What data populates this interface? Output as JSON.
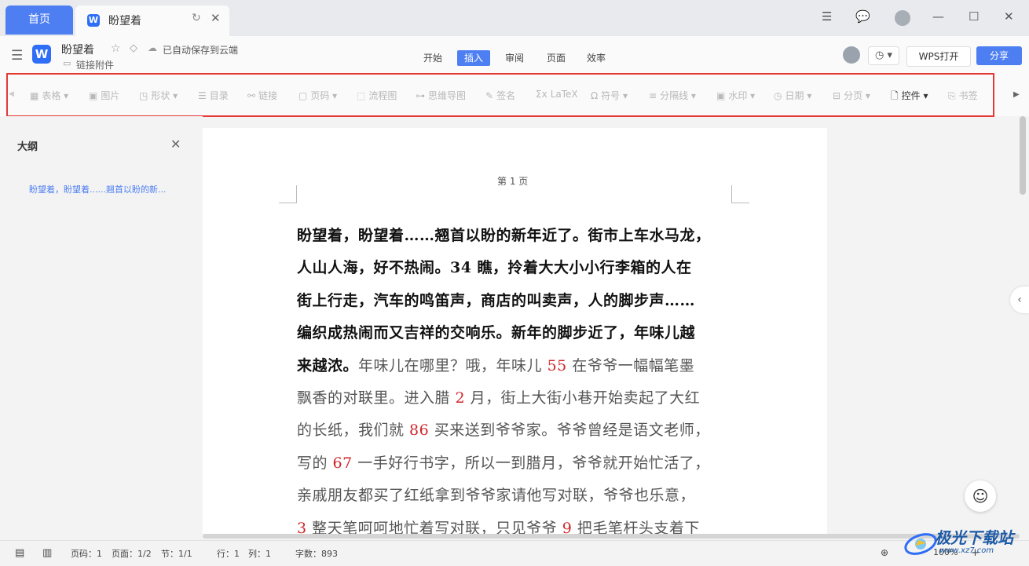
{
  "tabs": {
    "home_label": "首页",
    "doc_title": "盼望着"
  },
  "header": {
    "doc_title": "盼望着",
    "save_status": "已自动保存到云端",
    "attach_link": "链接附件",
    "menu": [
      "开始",
      "插入",
      "审阅",
      "页面",
      "效率"
    ],
    "active_menu": "插入",
    "wps_open": "WPS打开",
    "share": "分享"
  },
  "toolbar": {
    "items": [
      "表格",
      "图片",
      "形状",
      "目录",
      "链接",
      "页码",
      "流程图",
      "思维导图",
      "签名",
      "LaTeX",
      "符号",
      "分隔线",
      "水印",
      "日期",
      "分页",
      "控件",
      "书签"
    ]
  },
  "outline": {
    "title": "大纲",
    "item": "盼望着，盼望着......翘首以盼的新..."
  },
  "page": {
    "page_label": "第 1 页",
    "lines": [
      [
        {
          "t": "盼望着，盼望着……翘首以盼的新年近了。街市上车水马龙，",
          "c": "b"
        }
      ],
      [
        {
          "t": "人山人海，好不热闹。34 瞧，拎着大大小小行李箱的人在",
          "c": "b"
        }
      ],
      [
        {
          "t": "街上行走，汽车的鸣笛声，商店的叫卖声，人的脚步声……",
          "c": "b"
        }
      ],
      [
        {
          "t": "编织成热闹而又吉祥的交响乐。新年的脚步近了，年味儿越",
          "c": "b"
        }
      ],
      [
        {
          "t": "来越浓。",
          "c": "b"
        },
        {
          "t": "年味儿在哪里？哦，年味儿 ",
          "c": "g"
        },
        {
          "t": "55",
          "c": "r"
        },
        {
          "t": " 在爷爷一幅幅笔墨",
          "c": "g"
        }
      ],
      [
        {
          "t": "飘香的对联里。进入腊 ",
          "c": "g"
        },
        {
          "t": "2",
          "c": "r"
        },
        {
          "t": " 月，街上大街小巷开始卖起了大红",
          "c": "g"
        }
      ],
      [
        {
          "t": "的长纸，我们就 ",
          "c": "g"
        },
        {
          "t": "86",
          "c": "r"
        },
        {
          "t": " 买来送到爷爷家。爷爷曾经是语文老师，",
          "c": "g"
        }
      ],
      [
        {
          "t": "写的 ",
          "c": "g"
        },
        {
          "t": "67",
          "c": "r"
        },
        {
          "t": " 一手好行书字，所以一到腊月，爷爷就开始忙活了，",
          "c": "g"
        }
      ],
      [
        {
          "t": "亲戚朋友都买了红纸拿到爷爷家请他写对联，爷爷也乐意，",
          "c": "g"
        }
      ],
      [
        {
          "t": "3",
          "c": "r"
        },
        {
          "t": " 整天笔呵呵地忙着写对联，只见爷爷 ",
          "c": "g"
        },
        {
          "t": "9",
          "c": "r"
        },
        {
          "t": " 把毛笔杆头支着下",
          "c": "g"
        }
      ]
    ]
  },
  "status": {
    "page_code": "页码：1",
    "page": "页面：1/2",
    "section": "节：1/1",
    "row": "行：1",
    "col": "列：1",
    "words": "字数：893",
    "zoom": "100%"
  },
  "watermark": {
    "name": "极光下载站",
    "url": "www.xz7.com"
  },
  "colors": {
    "accent": "#4e7ff2",
    "highlight_border": "#e53935",
    "red_number": "#d0252a"
  }
}
